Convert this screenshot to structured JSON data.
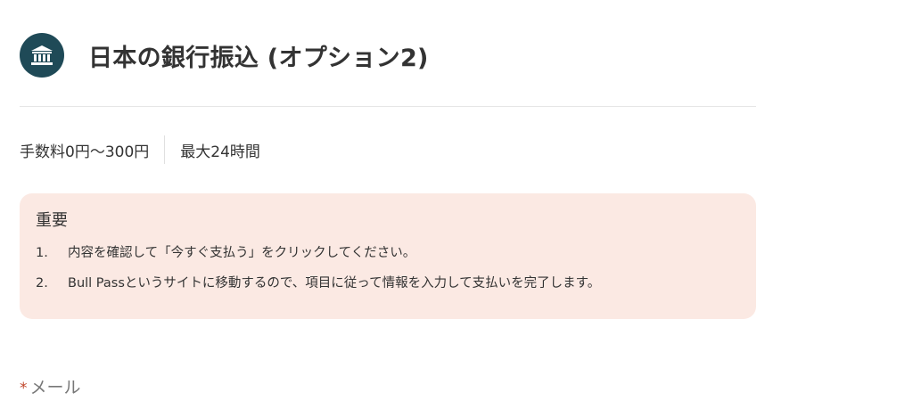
{
  "header": {
    "icon": "bank-icon",
    "title": "日本の銀行振込 (オプション2)"
  },
  "meta": {
    "fee": "手数料0円～300円",
    "time": "最大24時間"
  },
  "notice": {
    "title": "重要",
    "items": [
      {
        "num": "1.",
        "text": "内容を確認して「今すぐ支払う」をクリックしてください。"
      },
      {
        "num": "2.",
        "text": "Bull Passというサイトに移動するので、項目に従って情報を入力して支払いを完了します。"
      }
    ]
  },
  "form": {
    "email_required_mark": "*",
    "email_label": "メール"
  },
  "colors": {
    "icon_bg": "#1f4a57",
    "notice_bg": "#fbe9e3",
    "required": "#c0462b"
  }
}
